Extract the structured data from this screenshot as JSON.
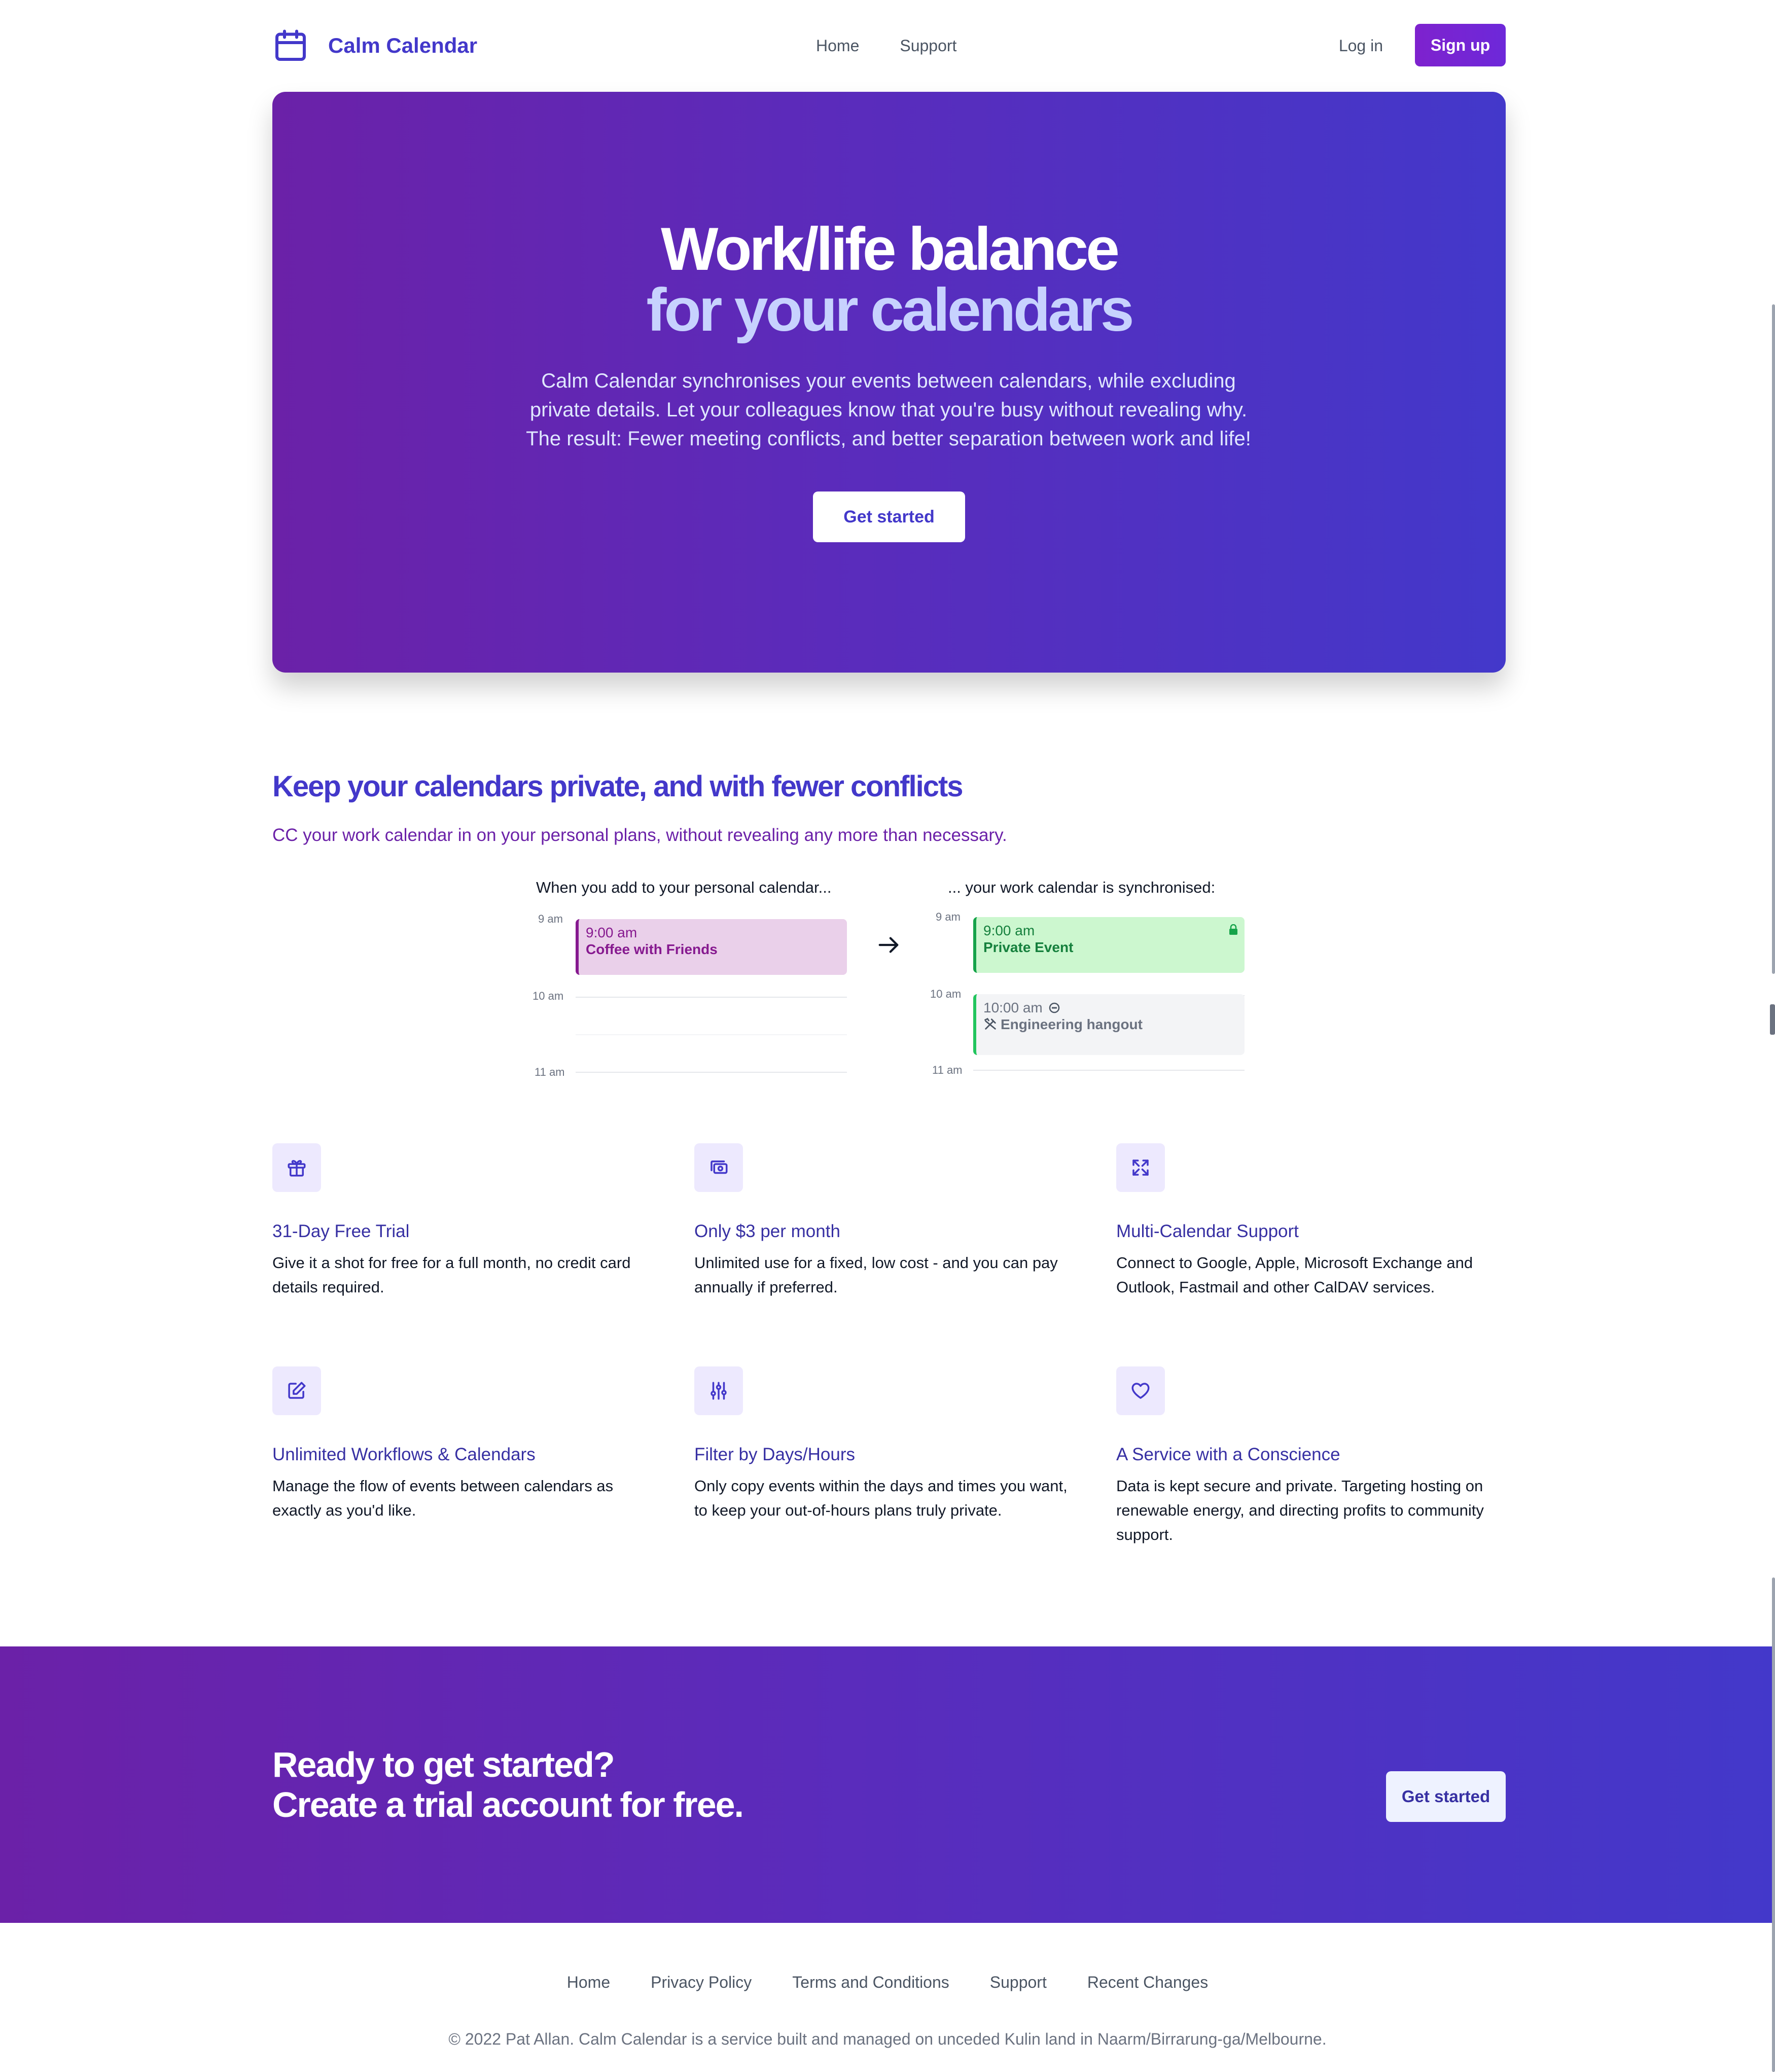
{
  "nav": {
    "brand": "Calm Calendar",
    "links": [
      "Home",
      "Support"
    ],
    "login": "Log in",
    "signup": "Sign up"
  },
  "hero": {
    "title_line1": "Work/life balance",
    "title_line2": "for your calendars",
    "description": "Calm Calendar synchronises your events between calendars, while excluding private details. Let your colleagues know that you're busy without revealing why. The result: Fewer meeting conflicts, and better separation between work and life!",
    "cta": "Get started"
  },
  "privacy": {
    "title": "Keep your calendars private, and with fewer conflicts",
    "subtitle": "CC your work calendar in on your personal plans, without revealing any more than necessary.",
    "left_caption": "When you add to your personal calendar...",
    "right_caption": "... your work calendar is synchronised:",
    "times": [
      "9 am",
      "10 am",
      "11 am"
    ],
    "personal_event": {
      "time": "9:00 am",
      "title": "Coffee with Friends"
    },
    "work_events": [
      {
        "time": "9:00 am",
        "title": "Private Event"
      },
      {
        "time": "10:00 am",
        "title": "Engineering hangout"
      }
    ]
  },
  "features": [
    {
      "icon": "gift-icon",
      "title": "31-Day Free Trial",
      "desc": "Give it a shot for free for a full month, no credit card details required."
    },
    {
      "icon": "money-icon",
      "title": "Only $3 per month",
      "desc": "Unlimited use for a fixed, low cost - and you can pay annually if preferred."
    },
    {
      "icon": "expand-icon",
      "title": "Multi-Calendar Support",
      "desc": "Connect to Google, Apple, Microsoft Exchange and Outlook, Fastmail and other CalDAV services."
    },
    {
      "icon": "edit-icon",
      "title": "Unlimited Workflows & Calendars",
      "desc": "Manage the flow of events between calendars as exactly as you'd like."
    },
    {
      "icon": "sliders-icon",
      "title": "Filter by Days/Hours",
      "desc": "Only copy events within the days and times you want, to keep your out-of-hours plans truly private."
    },
    {
      "icon": "heart-icon",
      "title": "A Service with a Conscience",
      "desc": "Data is kept secure and private. Targeting hosting on renewable energy, and directing profits to community support."
    }
  ],
  "cta_band": {
    "line1": "Ready to get started?",
    "line2": "Create a trial account for free.",
    "button": "Get started"
  },
  "footer": {
    "links": [
      "Home",
      "Privacy Policy",
      "Terms and Conditions",
      "Support",
      "Recent Changes"
    ],
    "copyright": "© 2022 Pat Allan. Calm Calendar is a service built and managed on unceded Kulin land in Naarm/Birrarung-ga/Melbourne."
  },
  "colors": {
    "brand": "#4338ca",
    "accent_purple": "#6b21a8",
    "signup": "#7e22ce"
  }
}
